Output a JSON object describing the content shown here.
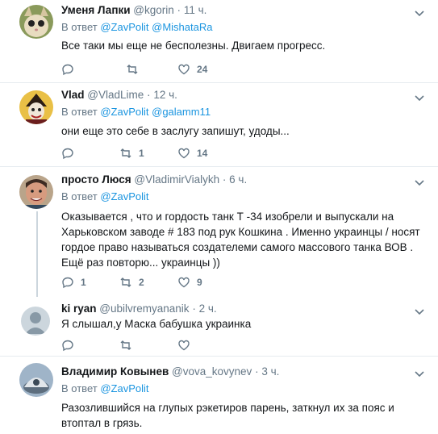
{
  "reply_prefix": "В ответ",
  "tweets": [
    {
      "name": "Уменя Лапки",
      "handle": "@kgorin",
      "time": "11 ч.",
      "mentions": [
        "@ZavPolit",
        "@MishataRa"
      ],
      "text": "Все таки мы еще не бесполезны. Двигаем прогресс.",
      "replies": "",
      "retweets": "",
      "likes": "24"
    },
    {
      "name": "Vlad",
      "handle": "@VladLime",
      "time": "12 ч.",
      "mentions": [
        "@ZavPolit",
        "@galamm11"
      ],
      "text": "они еще это себе в заслугу запишут, удоды...",
      "replies": "",
      "retweets": "1",
      "likes": "14"
    },
    {
      "name": "просто Люся",
      "handle": "@VladimirVialykh",
      "time": "6 ч.",
      "mentions": [
        "@ZavPolit"
      ],
      "text": "Оказывается , что и гордость  танк Т -34 изобрели и выпускали на Харьковском заводе # 183 под рук Кошкина . Именно украинцы / носят гордое право называться создателеми самого массового танка ВОВ . Ещё раз повторю... украинцы ))",
      "replies": "1",
      "retweets": "2",
      "likes": "9"
    },
    {
      "name": "ki ryan",
      "handle": "@ubilvremyananik",
      "time": "2 ч.",
      "mentions": [],
      "text": "Я слышал,у Маска бабушка украинка",
      "replies": "",
      "retweets": "",
      "likes": ""
    },
    {
      "name": "Владимир Ковынев",
      "handle": "@vova_kovynev",
      "time": "3 ч.",
      "mentions": [
        "@ZavPolit"
      ],
      "text": "Разозлившийся на глупых рэкетиров парень, заткнул их за пояс и втоптал в грязь.",
      "replies": "",
      "retweets": "",
      "likes": ""
    }
  ]
}
